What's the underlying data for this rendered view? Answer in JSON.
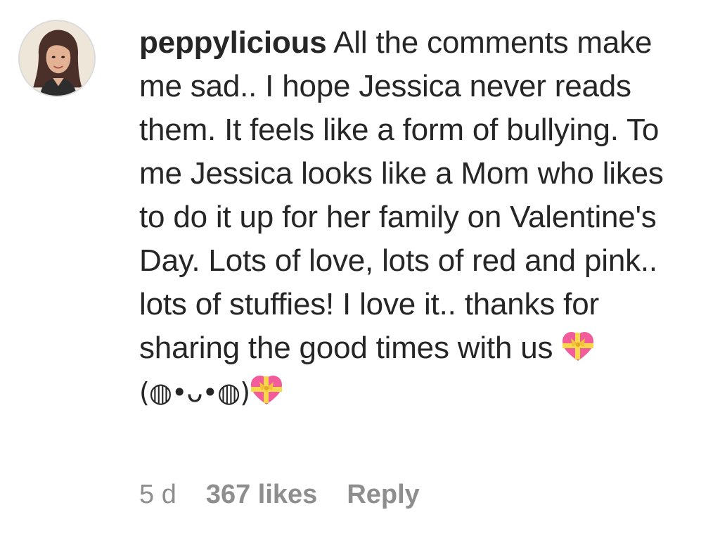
{
  "comment": {
    "username": "peppylicious",
    "text_part1": "All the comments make me sad.. I hope Jessica never reads them. It feels like a form of bullying. To me Jessica looks like a Mom who likes to do it up for her family on Valentine's Day. Lots of love, lots of red and pink.. lots of stuffies! I love it.. thanks for sharing the good times with us",
    "kaomoji": "(◍•ᴗ•◍)",
    "emoji_icon": "heart-with-ribbon-icon"
  },
  "meta": {
    "time": "5 d",
    "likes": "367 likes",
    "reply": "Reply"
  },
  "colors": {
    "text": "#262626",
    "secondary": "#8e8e8e",
    "emoji_pink": "#f25c9a"
  }
}
